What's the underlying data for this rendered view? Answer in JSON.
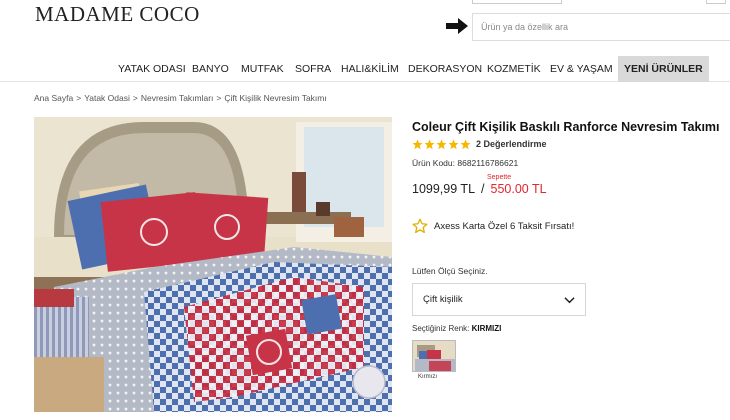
{
  "header": {
    "logo": "MADAME COCO",
    "search_placeholder": "Ürün ya da özellik ara"
  },
  "nav": {
    "items": [
      "YATAK ODASI",
      "BANYO",
      "MUTFAK",
      "SOFRA",
      "HALI&KİLİM",
      "DEKORASYON",
      "KOZMETİK",
      "EV & YAŞAM",
      "YENİ ÜRÜNLER"
    ]
  },
  "breadcrumb": [
    "Ana Sayfa",
    "Yatak Odasi",
    "Nevresim Takımları",
    "Çift Kişilik Nevresim Takımı"
  ],
  "product": {
    "title": "Coleur Çift Kişilik Baskılı Ranforce Nevresim Takımı",
    "rating_stars": 5,
    "rating_text": "2 Değerlendirme",
    "code": "Ürün Kodu: 8682116786621",
    "price": "1099,99 TL",
    "price_separator": "/",
    "cart_label": "Sepette",
    "sale_price": "550.00 TL",
    "promo_text": "Axess Karta Özel 6 Taksit Fırsatı!",
    "size_label": "Lütfen Ölçü Seçiniz.",
    "size_value": "Çift kişilik",
    "color_label": "Seçtiğiniz Renk:",
    "color_value": "KIRMIZI",
    "swatch_name": "Kırmızı"
  },
  "colors": {
    "accent_red": "#e1262d",
    "star_gold": "#f5b800",
    "nav_highlight": "#d9d9d9"
  }
}
